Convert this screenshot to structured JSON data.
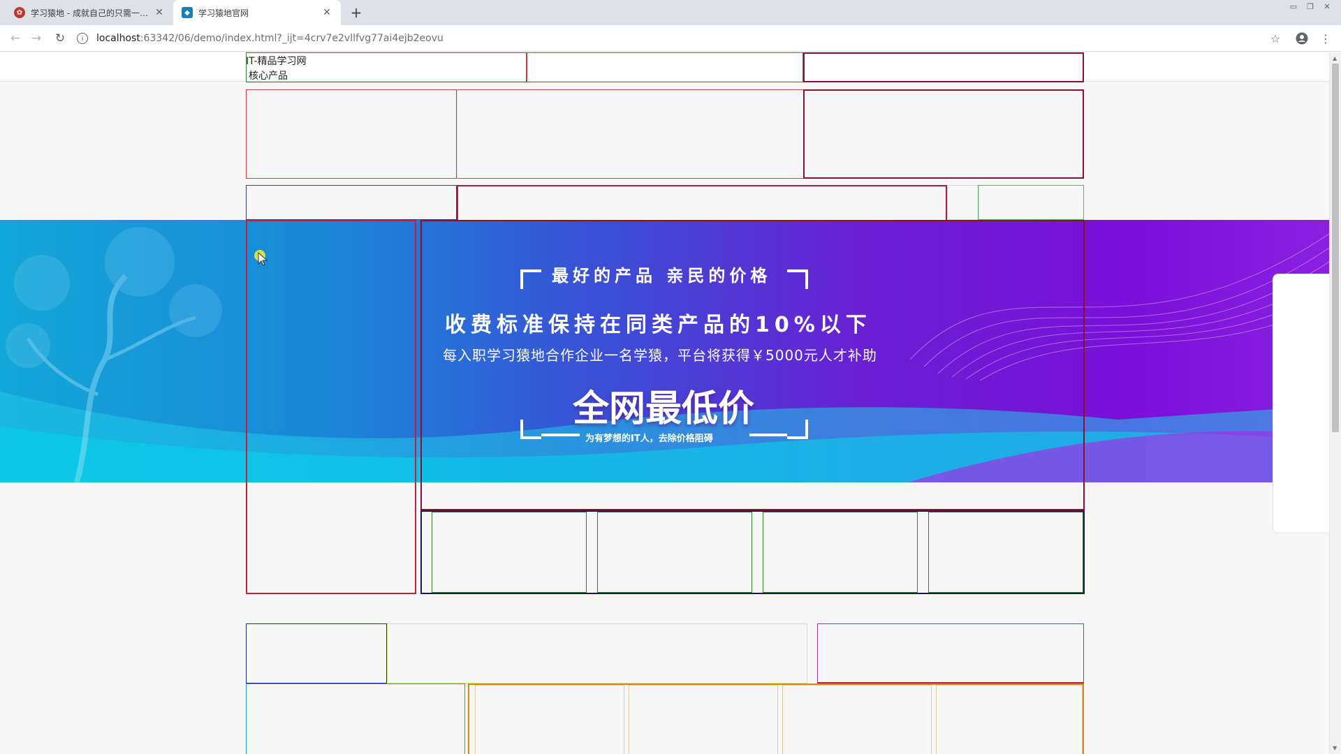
{
  "browser": {
    "tabs": [
      {
        "title": "学习猿地 - 成就自己的只需一套精品",
        "favicon": "ape-logo-icon",
        "active": false
      },
      {
        "title": "学习猿地官网",
        "favicon": "ape-site-icon",
        "active": true
      }
    ],
    "new_tab_label": "+",
    "url_host": "localhost",
    "url_rest": ":63342/06/demo/index.html?_ijt=4crv7e2vllfvg77ai4ejb2eovu",
    "window_controls": [
      "minimize",
      "restore",
      "close"
    ]
  },
  "page": {
    "logo_text": "IT-精品学习网",
    "core_product_text": "核心产品",
    "banner": {
      "slogan_top": "最好的产品  亲民的价格",
      "slogan_main": "收费标准保持在同类产品的10%以下",
      "slogan_sub": "每入职学习猿地合作企业一名学猿，平台将获得￥5000元人才补助",
      "slogan_big": "全网最低价",
      "slogan_bottom": "为有梦想的IT人，去除价格阻碍",
      "colors": {
        "left": "#13a7d8",
        "mid": "#3a4fd6",
        "right": "#8a20e0"
      }
    }
  }
}
